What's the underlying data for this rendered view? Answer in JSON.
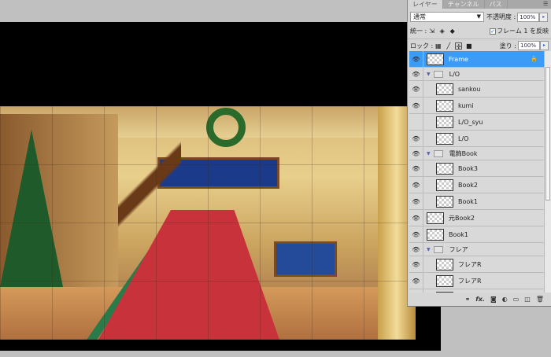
{
  "layers_panel": {
    "tabs": [
      {
        "label": "レイヤー",
        "active": true
      },
      {
        "label": "チャンネル",
        "active": false
      },
      {
        "label": "パス",
        "active": false
      }
    ],
    "blend_mode": "通常",
    "opacity_label": "不透明度 :",
    "opacity_value": "100%",
    "unify_label": "統一 :",
    "propagate_frame_label": "フレーム 1 を反映",
    "propagate_frame_checked": true,
    "lock_label": "ロック :",
    "fill_label": "塗り :",
    "fill_value": "100%",
    "layers": [
      {
        "name": "Frame",
        "visible": true,
        "selected": true,
        "locked": true
      },
      {
        "name": "L/O",
        "visible": true,
        "group": true,
        "expanded": true
      },
      {
        "name": "sankou",
        "visible": true,
        "indent": true
      },
      {
        "name": "kumi",
        "visible": true,
        "indent": true
      },
      {
        "name": "L/O_syu",
        "visible": false,
        "indent": true
      },
      {
        "name": "L/O",
        "visible": true,
        "indent": true
      },
      {
        "name": "電飾Book",
        "visible": true,
        "group": true,
        "expanded": true
      },
      {
        "name": "Book3",
        "visible": true,
        "indent": true
      },
      {
        "name": "Book2",
        "visible": true,
        "indent": true
      },
      {
        "name": "Book1",
        "visible": true,
        "indent": true
      },
      {
        "name": "元Book2",
        "visible": true
      },
      {
        "name": "Book1",
        "visible": true
      },
      {
        "name": "フレア",
        "visible": true,
        "group": true,
        "expanded": true
      },
      {
        "name": "フレアR",
        "visible": true,
        "indent": true
      },
      {
        "name": "フレアR",
        "visible": true,
        "indent": true
      },
      {
        "name": "",
        "visible": true,
        "indent": true
      }
    ],
    "footer_icons": [
      "link-icon",
      "fx-icon",
      "mask-icon",
      "adjustment-icon",
      "new-group-icon",
      "new-layer-icon",
      "trash-icon"
    ],
    "footer_fx_label": "fx."
  },
  "colors": {
    "selection": "#3c9cf5",
    "canvas_bg": "#000000",
    "workspace_bg": "#c0c0c0"
  }
}
